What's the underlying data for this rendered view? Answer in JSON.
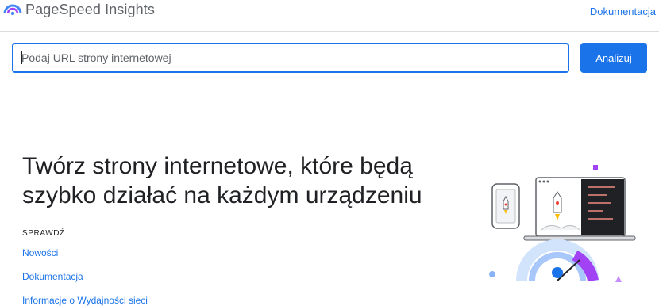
{
  "header": {
    "app_title": "PageSpeed Insights",
    "docs_link": "Dokumentacja"
  },
  "search": {
    "placeholder": "Podaj URL strony internetowej",
    "value": "",
    "button_label": "Analizuj"
  },
  "hero": {
    "headline_line1": "Twórz strony internetowe, które będą",
    "headline_line2": "szybko działać na każdym urządzeniu"
  },
  "check_section": {
    "label": "SPRAWDŹ",
    "links": [
      "Nowości",
      "Dokumentacja",
      "Informacje o Wydajności sieci"
    ]
  },
  "colors": {
    "accent": "#1a73e8",
    "text": "#202124",
    "muted": "#5f6368",
    "border": "#dadce0"
  },
  "icons": {
    "logo": "pagespeed-logo-icon",
    "illustration": "speed-gauge-illustration"
  }
}
